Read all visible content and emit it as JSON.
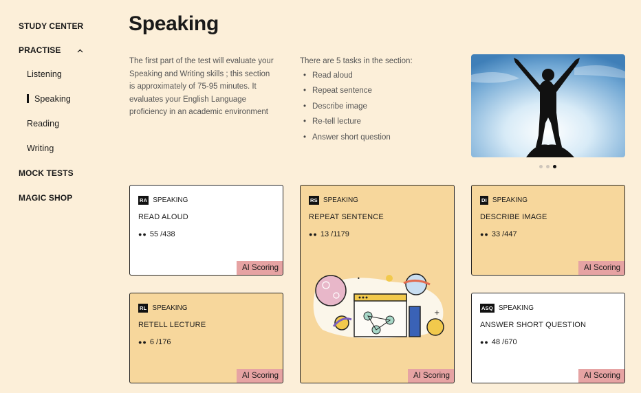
{
  "sidebar": {
    "study_center": "STUDY CENTER",
    "practise": "PRACTISE",
    "practise_chevron": "^",
    "listening": "Listening",
    "speaking": "Speaking",
    "reading": "Reading",
    "writing": "Writing",
    "mock_tests": "MOCK TESTS",
    "magic_shop": "MAGIC SHOP"
  },
  "main": {
    "title": "Speaking",
    "intro": "The first part of the test will evaluate your Speaking and Writing skills ; this section is approximately of 75-95 minutes. It evaluates your English Language proficiency in an academic environment",
    "tasks_heading": "There are 5 tasks in the section:",
    "tasks": [
      "Read aloud",
      "Repeat sentence",
      "Describe image",
      "Re-tell lecture",
      "Answer short question"
    ],
    "carousel": {
      "slides": 3,
      "active_index": 2
    }
  },
  "cards": [
    {
      "badge": "RA",
      "category": "SPEAKING",
      "title": "READ ALOUD",
      "count": "55 /438",
      "tag": "AI Scoring"
    },
    {
      "badge": "RS",
      "category": "SPEAKING",
      "title": "REPEAT SENTENCE",
      "count": "13 /1179",
      "tag": "AI Scoring"
    },
    {
      "badge": "DI",
      "category": "SPEAKING",
      "title": "DESCRIBE IMAGE",
      "count": "33 /447",
      "tag": "AI Scoring"
    },
    {
      "badge": "RL",
      "category": "SPEAKING",
      "title": "RETELL LECTURE",
      "count": "6 /176",
      "tag": "AI Scoring"
    },
    {
      "badge": "ASQ",
      "category": "SPEAKING",
      "title": "ANSWER SHORT QUESTION",
      "count": "48 /670",
      "tag": "AI Scoring"
    }
  ],
  "count_dots": "●●",
  "colors": {
    "background": "#fcefd9",
    "card_tan": "#f7d79c",
    "ai_tag": "#e6a3a3"
  }
}
